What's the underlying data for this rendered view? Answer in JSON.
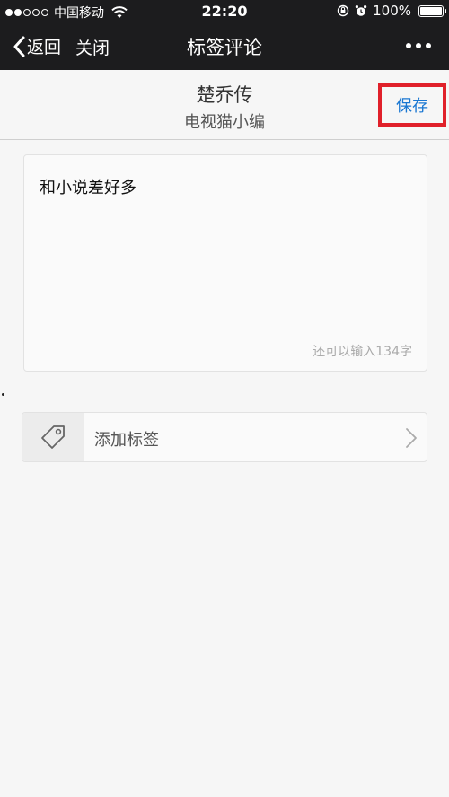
{
  "status_bar": {
    "carrier": "中国移动",
    "time": "22:20",
    "battery": "100%"
  },
  "nav": {
    "back_label": "返回",
    "close_label": "关闭",
    "title": "标签评论"
  },
  "header": {
    "book_title": "楚乔传",
    "book_author": "电视猫小编",
    "save_label": "保存"
  },
  "comment": {
    "text": "和小说差好多",
    "remaining": "还可以输入134字"
  },
  "tag": {
    "add_label": "添加标签"
  },
  "colors": {
    "accent_blue": "#1a77d2",
    "highlight_red": "#e0202a",
    "nav_bg": "#1c1c1e"
  }
}
